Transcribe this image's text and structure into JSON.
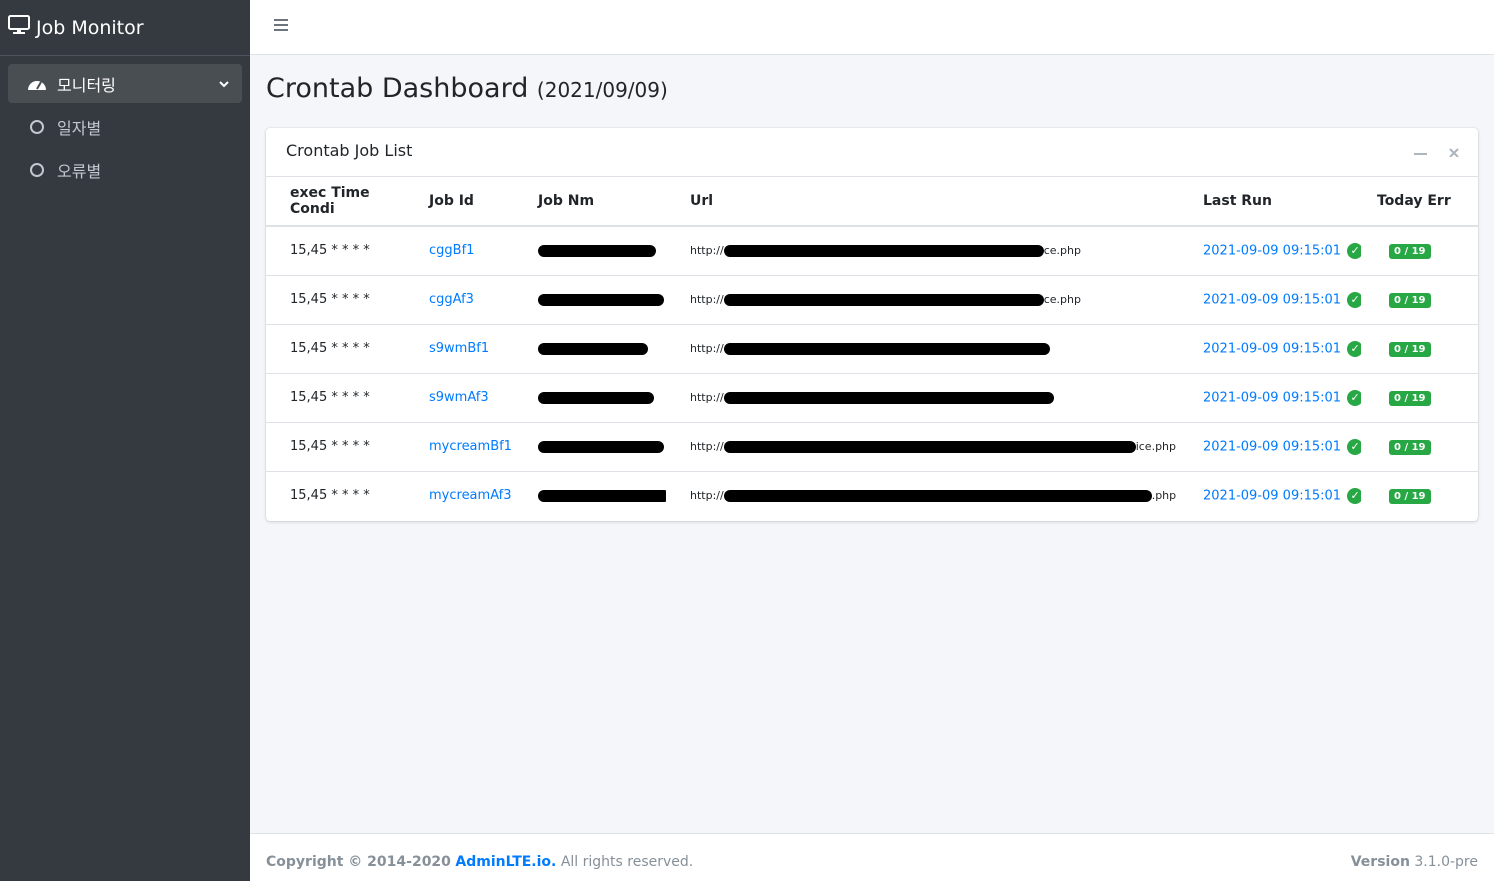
{
  "sidebar": {
    "brand": "Job Monitor",
    "items": [
      {
        "label": "모니터링",
        "icon": "tachometer-icon"
      },
      {
        "label": "일자별",
        "icon": "circle-icon"
      },
      {
        "label": "오류별",
        "icon": "circle-icon"
      }
    ]
  },
  "header": {
    "title": "Crontab Dashboard",
    "date": "(2021/09/09)"
  },
  "card": {
    "title": "Crontab Job List",
    "columns": [
      "exec Time Condi",
      "Job Id",
      "Job Nm",
      "Url",
      "Last Run",
      "Today Err"
    ],
    "rows": [
      {
        "cond": "15,45 * * * *",
        "job_id": "cggBf1",
        "url_prefix": "http://",
        "url_suffix": "ce.php",
        "last_run": "2021-09-09 09:15:01",
        "err": "0 / 19"
      },
      {
        "cond": "15,45 * * * *",
        "job_id": "cggAf3",
        "url_prefix": "http://",
        "url_suffix": "ce.php",
        "last_run": "2021-09-09 09:15:01",
        "err": "0 / 19"
      },
      {
        "cond": "15,45 * * * *",
        "job_id": "s9wmBf1",
        "url_prefix": "http://",
        "url_suffix": "",
        "last_run": "2021-09-09 09:15:01",
        "err": "0 / 19"
      },
      {
        "cond": "15,45 * * * *",
        "job_id": "s9wmAf3",
        "url_prefix": "http://",
        "url_suffix": "",
        "last_run": "2021-09-09 09:15:01",
        "err": "0 / 19"
      },
      {
        "cond": "15,45 * * * *",
        "job_id": "mycreamBf1",
        "url_prefix": "http://",
        "url_suffix": "ice.php",
        "last_run": "2021-09-09 09:15:01",
        "err": "0 / 19"
      },
      {
        "cond": "15,45 * * * *",
        "job_id": "mycreamAf3",
        "url_prefix": "http://",
        "url_suffix": ".php",
        "last_run": "2021-09-09 09:15:01",
        "err": "0 / 19"
      }
    ]
  },
  "footer": {
    "copyright": "Copyright © 2014-2020",
    "brand": "AdminLTE.io.",
    "rights": "All rights reserved.",
    "version_label": "Version",
    "version": "3.1.0-pre"
  }
}
